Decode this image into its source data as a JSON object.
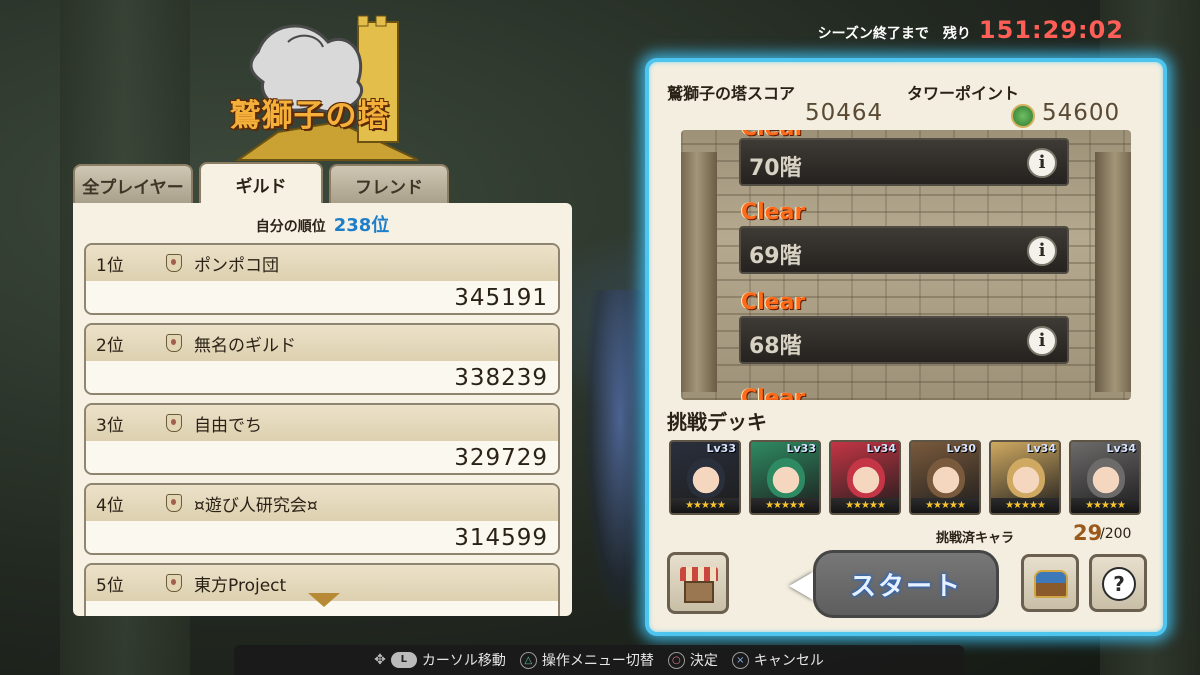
{
  "logo": {
    "title": "鷲獅子の塔"
  },
  "season": {
    "label": "シーズン終了まで　残り",
    "time": "151:29:02"
  },
  "tabs": [
    {
      "label": "全プレイヤー"
    },
    {
      "label": "ギルド",
      "selected": true
    },
    {
      "label": "フレンド"
    }
  ],
  "ranking": {
    "my_rank_label": "自分の順位",
    "my_rank_value": "238位",
    "rows": [
      {
        "rank": "1位",
        "name": "ポンポコ団",
        "score": "345191"
      },
      {
        "rank": "2位",
        "name": "無名のギルド",
        "score": "338239"
      },
      {
        "rank": "3位",
        "name": "自由でち",
        "score": "329729"
      },
      {
        "rank": "4位",
        "name": "¤遊び人研究会¤",
        "score": "314599"
      },
      {
        "rank": "5位",
        "name": "東方Project",
        "score": ""
      }
    ]
  },
  "tower": {
    "score_label": "鷲獅子の塔スコア",
    "score_value": "50464",
    "points_label": "タワーポイント",
    "points_value": "54600",
    "floors": [
      {
        "name": "70階",
        "status": "Clear"
      },
      {
        "name": "69階",
        "status": "Clear"
      },
      {
        "name": "68階",
        "status": "Clear"
      }
    ],
    "clear_peek": "Clear"
  },
  "deck": {
    "label": "挑戦デッキ",
    "members": [
      {
        "level": "Lv33",
        "stars": "★★★★★",
        "color": "#2a2f3c"
      },
      {
        "level": "Lv33",
        "stars": "★★★★★",
        "color": "#2e8a62"
      },
      {
        "level": "Lv34",
        "stars": "★★★★★",
        "color": "#c43545"
      },
      {
        "level": "Lv30",
        "stars": "★★★★★",
        "color": "#7a5a3c"
      },
      {
        "level": "Lv34",
        "stars": "★★★★★",
        "color": "#cfa961"
      },
      {
        "level": "Lv34",
        "stars": "★★★★★",
        "color": "#6d6a6a"
      }
    ],
    "challenged_label": "挑戦済キャラ",
    "challenged_current": "29",
    "challenged_max": "/200"
  },
  "buttons": {
    "start": "スタート",
    "help": "?"
  },
  "guide": [
    {
      "icon": "L",
      "label": "カーソル移動"
    },
    {
      "icon": "△",
      "label": "操作メニュー切替"
    },
    {
      "icon": "○",
      "label": "決定"
    },
    {
      "icon": "×",
      "label": "キャンセル"
    }
  ],
  "colors": {
    "accent_blue": "#4ec5ef",
    "timer_red": "#ff5f57",
    "clear_orange": "#ff6a1a",
    "rank_blue": "#1d7fc9"
  }
}
